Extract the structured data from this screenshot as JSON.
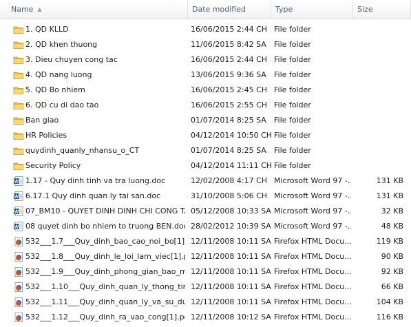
{
  "header": {
    "name": "Name",
    "date": "Date modified",
    "type": "Type",
    "size": "Size",
    "sort": "ascending"
  },
  "colors": {
    "folder": "#e8c05a",
    "word": "#2a5aa8",
    "firefox": "#d9542b",
    "header_text": "#4c607a"
  },
  "rows": [
    {
      "icon": "folder-icon",
      "name": "1. QD KLLD",
      "date": "16/06/2015 2:44 CH",
      "type": "File folder",
      "size": ""
    },
    {
      "icon": "folder-icon",
      "name": "2. QD khen thuong",
      "date": "11/06/2015 8:42 SA",
      "type": "File folder",
      "size": ""
    },
    {
      "icon": "folder-icon",
      "name": "3. Dieu chuyen cong tac",
      "date": "16/06/2015 2:44 CH",
      "type": "File folder",
      "size": ""
    },
    {
      "icon": "folder-icon",
      "name": "4. QD nang luong",
      "date": "13/06/2015 9:36 SA",
      "type": "File folder",
      "size": ""
    },
    {
      "icon": "folder-icon",
      "name": "5. QD Bo nhiem",
      "date": "16/06/2015 2:45 CH",
      "type": "File folder",
      "size": ""
    },
    {
      "icon": "folder-icon",
      "name": "6. QD cu di dao tao",
      "date": "16/06/2015 2:55 CH",
      "type": "File folder",
      "size": ""
    },
    {
      "icon": "folder-icon",
      "name": "Ban giao",
      "date": "01/07/2014 8:25 SA",
      "type": "File folder",
      "size": ""
    },
    {
      "icon": "folder-icon",
      "name": "HR Policies",
      "date": "04/12/2014 10:50 CH",
      "type": "File folder",
      "size": ""
    },
    {
      "icon": "folder-icon",
      "name": "quydinh_quanly_nhansu_o_CT",
      "date": "01/07/2014 8:25 SA",
      "type": "File folder",
      "size": ""
    },
    {
      "icon": "folder-icon",
      "name": "Security Policy",
      "date": "04/12/2014 11:11 CH",
      "type": "File folder",
      "size": ""
    },
    {
      "icon": "word-doc-icon",
      "name": "1.17 - Quy dinh tinh va tra luong.doc",
      "date": "12/02/2008 4:17 CH",
      "type": "Microsoft Word 97 -...",
      "size": "131 KB"
    },
    {
      "icon": "word-doc-icon",
      "name": "6.17.1 Quy dinh quan ly tai san.doc",
      "date": "31/10/2008 5:06 CH",
      "type": "Microsoft Word 97 -...",
      "size": "131 KB"
    },
    {
      "icon": "word-doc-icon",
      "name": "07_BM10 - QUYET DINH DINH CHI CONG TA...",
      "date": "05/12/2008 10:33 SA",
      "type": "Microsoft Word 97 -...",
      "size": "32 KB"
    },
    {
      "icon": "word-doc-icon",
      "name": "08 quyet dinh bo nhiem to truong BEN.doc",
      "date": "28/02/2012 10:39 SA",
      "type": "Microsoft Word 97 -...",
      "size": "48 KB"
    },
    {
      "icon": "firefox-html-icon",
      "name": "532___1.7___Quy_dinh_bao_cao_noi_bo[1]...",
      "date": "12/11/2008 10:11 SA",
      "type": "Firefox HTML Docu...",
      "size": "119 KB"
    },
    {
      "icon": "firefox-html-icon",
      "name": "532___1.8___Quy_dinh_le_loi_lam_viec[1].pdf",
      "date": "12/11/2008 10:11 SA",
      "type": "Firefox HTML Docu...",
      "size": "90 KB"
    },
    {
      "icon": "firefox-html-icon",
      "name": "532___1.9___Quy_dinh_phong_gian_bao_m...",
      "date": "12/11/2008 10:11 SA",
      "type": "Firefox HTML Docu...",
      "size": "92 KB"
    },
    {
      "icon": "firefox-html-icon",
      "name": "532___1.10___Quy_dinh_quan_ly_thong_tin[...",
      "date": "12/11/2008 10:11 SA",
      "type": "Firefox HTML Docu...",
      "size": "66 KB"
    },
    {
      "icon": "firefox-html-icon",
      "name": "532___1.11___Quy_dinh_quan_ly_va_su_du...",
      "date": "12/11/2008 10:11 SA",
      "type": "Firefox HTML Docu...",
      "size": "104 KB"
    },
    {
      "icon": "firefox-html-icon",
      "name": "532___1.12___Quy_dinh_ra_vao_cong[1].pdf",
      "date": "12/11/2008 10:12 SA",
      "type": "Firefox HTML Docu...",
      "size": "116 KB"
    }
  ]
}
